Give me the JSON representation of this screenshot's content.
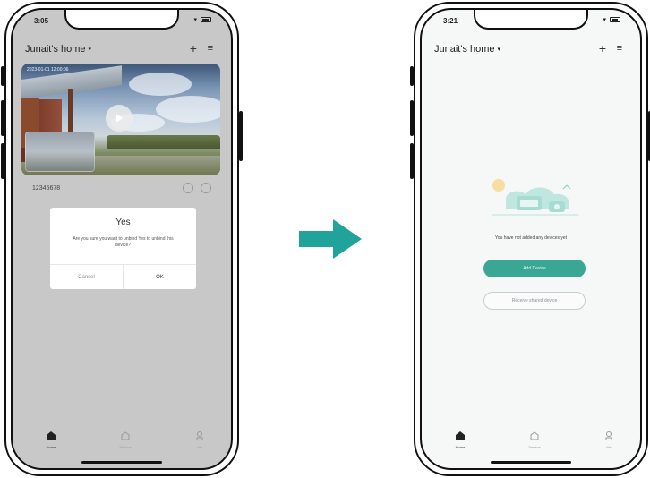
{
  "screen_before": {
    "status": {
      "time": "3:05",
      "icons": "▾ ▮"
    },
    "header": {
      "home_title": "Junait's home",
      "caret": "▾",
      "plus_label": "+",
      "menu_label": "≡"
    },
    "camera": {
      "timestamp": "2023-01-01 12:00:06",
      "device_name": "12345678"
    },
    "dialog": {
      "title": "Yes",
      "message": "Are you sure you want to unbind Yes to unbind this device?",
      "cancel_label": "Cancel",
      "ok_label": "OK"
    },
    "tabs": [
      {
        "label": "Home",
        "icon": "home-icon"
      },
      {
        "label": "Service",
        "icon": "service-icon"
      },
      {
        "label": "Me",
        "icon": "profile-icon"
      }
    ]
  },
  "screen_after": {
    "status": {
      "time": "3:21",
      "icons": "▾ ▮"
    },
    "header": {
      "home_title": "Junait's home",
      "caret": "▾",
      "plus_label": "+",
      "menu_label": "≡"
    },
    "empty_state": {
      "message": "You have not added any devices yet",
      "illustration": "empty-devices-illustration"
    },
    "add_device_label": "Add Device",
    "share_label": "Receive shared device",
    "tabs": [
      {
        "label": "Home",
        "icon": "home-icon"
      },
      {
        "label": "Service",
        "icon": "service-icon"
      },
      {
        "label": "Me",
        "icon": "profile-icon"
      }
    ]
  },
  "colors": {
    "accent": "#3aa795",
    "arrow": "#1fa39a",
    "overlay": "#c8c8c8"
  }
}
